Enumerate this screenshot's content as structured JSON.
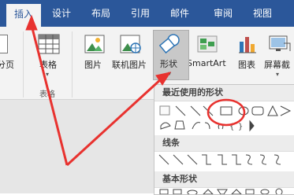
{
  "ribbon": {
    "tabs": [
      {
        "label": "插入",
        "active": true
      },
      {
        "label": "设计"
      },
      {
        "label": "布局"
      },
      {
        "label": "引用"
      },
      {
        "label": "邮件"
      },
      {
        "label": "审阅"
      },
      {
        "label": "视图"
      }
    ],
    "buttons": {
      "page": "分页",
      "table": "表格",
      "picture": "图片",
      "online_picture": "联机图片",
      "shapes": "形状",
      "smartart": "SmartArt",
      "chart": "图表",
      "screenshot": "屏幕截"
    },
    "groups": {
      "table_group": "表格"
    }
  },
  "shapes_menu": {
    "sections": [
      {
        "title": "最近使用的形状"
      },
      {
        "title": "线条"
      },
      {
        "title": "基本形状"
      }
    ]
  },
  "colors": {
    "accent": "#2b579a",
    "annotation": "#e8322f"
  }
}
